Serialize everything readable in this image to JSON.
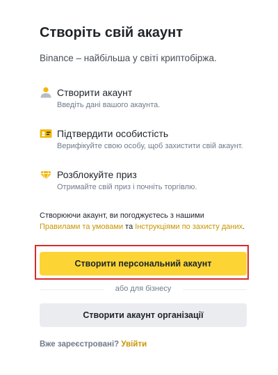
{
  "title": "Створіть свій акаунт",
  "subtitle": "Binance – найбільша у світі криптобіржа.",
  "steps": [
    {
      "icon": "user-icon",
      "heading": "Створити акаунт",
      "description": "Введіть дані вашого акаунта."
    },
    {
      "icon": "id-card-icon",
      "heading": "Підтвердити особистість",
      "description": "Верифікуйте свою особу, щоб захистити свій акаунт."
    },
    {
      "icon": "gift-diamond-icon",
      "heading": "Розблокуйте приз",
      "description": "Отримайте свій приз і почніть торгівлю."
    }
  ],
  "terms": {
    "line1": "Створюючи акаунт, ви погоджуєтесь з нашими",
    "link_terms": "Правилами та умовами",
    "connector": " та ",
    "link_privacy": "Інструкціями по захисту даних",
    "end": "."
  },
  "buttons": {
    "personal": "Створити персональний акаунт",
    "divider": "або для бізнесу",
    "organization": "Створити акаунт організації"
  },
  "login": {
    "prompt": "Вже зареєстровані?",
    "link": "Увійти"
  },
  "colors": {
    "accent": "#fcd535",
    "link": "#c99400",
    "highlight": "#d62b2b",
    "secondary_button": "#eaecef"
  }
}
